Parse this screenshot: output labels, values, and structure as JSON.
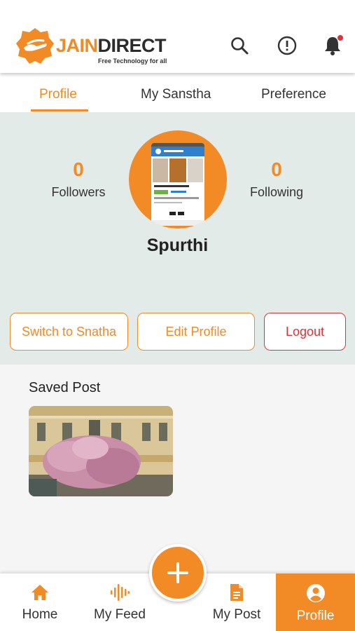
{
  "header": {
    "brand_part1": "JAIN",
    "brand_part2": "DIRECT",
    "tagline": "Free Technology for all",
    "icons": [
      "search-icon",
      "alert-circle-icon",
      "bell-icon"
    ],
    "notification_dot": true
  },
  "tabs": [
    {
      "label": "Profile",
      "active": true
    },
    {
      "label": "My Sanstha",
      "active": false
    },
    {
      "label": "Preference",
      "active": false
    }
  ],
  "profile": {
    "followers_count": "0",
    "followers_label": "Followers",
    "following_count": "0",
    "following_label": "Following",
    "username": "Spurthi"
  },
  "actions": {
    "switch_label": "Switch to Snatha",
    "edit_label": "Edit Profile",
    "logout_label": "Logout"
  },
  "saved": {
    "title": "Saved Post"
  },
  "bottom_nav": {
    "items": [
      {
        "label": "Home",
        "icon": "home-icon",
        "active": false
      },
      {
        "label": "My Feed",
        "icon": "audio-wave-icon",
        "active": false
      },
      {
        "label": "My Post",
        "icon": "document-icon",
        "active": false
      },
      {
        "label": "Profile",
        "icon": "user-circle-icon",
        "active": true
      }
    ],
    "fab_icon": "plus-icon"
  },
  "colors": {
    "accent": "#f28a25",
    "logout": "#e0323a",
    "panel_bg": "#e3ebe8"
  }
}
